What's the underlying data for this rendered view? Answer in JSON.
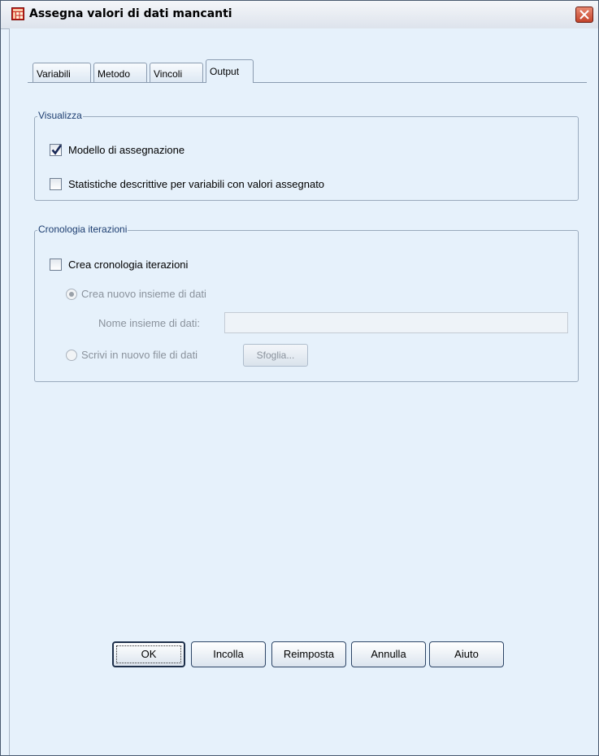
{
  "window": {
    "title": "Assegna valori di dati mancanti",
    "icon": "table-grid-icon",
    "close_icon": "close-icon"
  },
  "tabs": [
    {
      "label": "Variabili",
      "active": false
    },
    {
      "label": "Metodo",
      "active": false
    },
    {
      "label": "Vincoli",
      "active": false
    },
    {
      "label": "Output",
      "active": true
    }
  ],
  "visualizza": {
    "legend": "Visualizza",
    "model_label": "Modello di assegnazione",
    "model_checked": true,
    "stats_label": "Statistiche descrittive per variabili con valori assegnato",
    "stats_checked": false
  },
  "cronologia": {
    "legend": "Cronologia iterazioni",
    "create_label": "Crea cronologia iterazioni",
    "create_checked": false,
    "new_dataset_label": "Crea nuovo insieme di dati",
    "dataset_name_label": "Nome insieme di dati:",
    "dataset_name_value": "",
    "new_file_label": "Scrivi in nuovo file di dati",
    "browse_label": "Sfoglia..."
  },
  "buttons": {
    "ok": "OK",
    "paste": "Incolla",
    "reset": "Reimposta",
    "cancel": "Annulla",
    "help": "Aiuto"
  },
  "colors": {
    "panel_bg": "#e6f1fb",
    "group_label": "#1c3d70",
    "disabled_text": "#8a929c"
  }
}
